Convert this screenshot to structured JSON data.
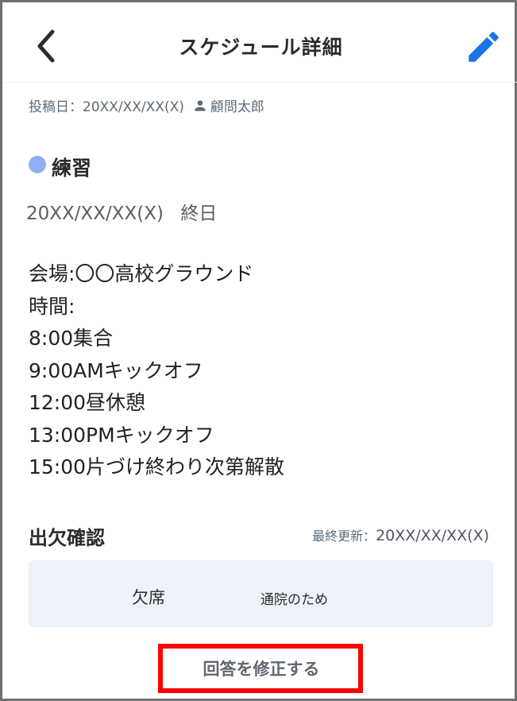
{
  "header": {
    "title": "スケジュール詳細",
    "back_icon": "chevron-left-icon",
    "edit_icon": "pencil-icon",
    "accent_color": "#1a73e8"
  },
  "post": {
    "posted_label": "投稿日：20XX/XX/XX(X)",
    "author_icon": "person-icon",
    "author": "顧問太郎"
  },
  "event": {
    "category": "練習",
    "category_color": "#8fb0f5",
    "date": "20XX/XX/XX(X)",
    "all_day": "終日",
    "description_lines": [
      "会場:〇〇高校グラウンド",
      "時間:",
      "8:00集合",
      "9:00AMキックオフ",
      "12:00昼休憩",
      "13:00PMキックオフ",
      "15:00片づけ終わり次第解散"
    ]
  },
  "attendance": {
    "title": "出欠確認",
    "last_updated_label": "最終更新：",
    "last_updated_date": "20XX/XX/XX(X)",
    "status": "欠席",
    "reason": "通院のため",
    "edit_answer_label": "回答を修正する"
  }
}
